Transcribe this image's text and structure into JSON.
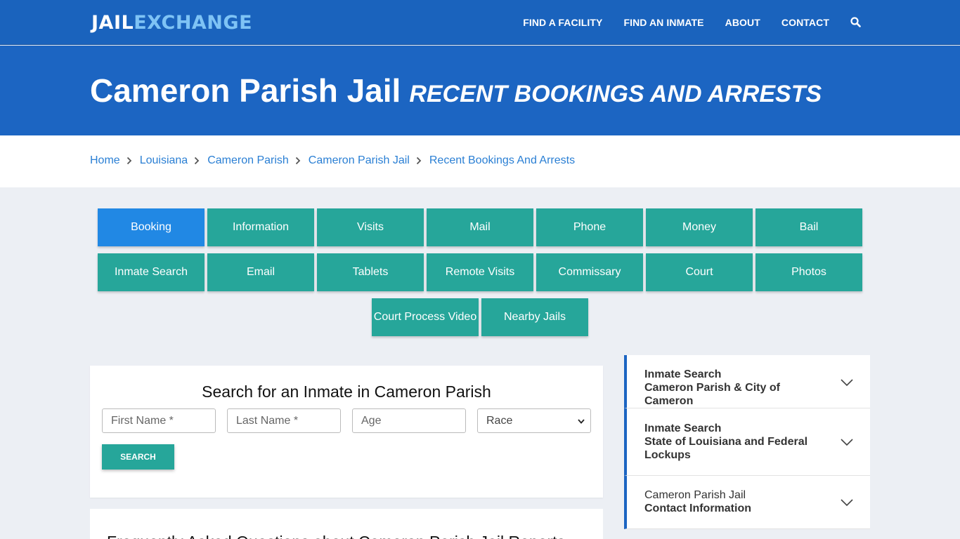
{
  "logo": {
    "part1": "JAIL",
    "part2": "EXCHANGE"
  },
  "nav": {
    "items": [
      "FIND A FACILITY",
      "FIND AN INMATE",
      "ABOUT",
      "CONTACT"
    ],
    "search_icon": "search-icon"
  },
  "hero": {
    "title": "Cameron Parish Jail",
    "subtitle": "RECENT BOOKINGS AND ARRESTS"
  },
  "breadcrumb": [
    "Home",
    "Louisiana",
    "Cameron Parish",
    "Cameron Parish Jail",
    "Recent Bookings And Arrests"
  ],
  "buttons": {
    "row1": [
      "Booking",
      "Information",
      "Visits",
      "Mail",
      "Phone",
      "Money",
      "Bail"
    ],
    "row2": [
      "Inmate Search",
      "Email",
      "Tablets",
      "Remote Visits",
      "Commissary",
      "Court",
      "Photos"
    ],
    "row3": [
      "Court Process Video",
      "Nearby Jails"
    ],
    "active": "Booking"
  },
  "search_card": {
    "title": "Search for an Inmate in Cameron Parish",
    "first_name_placeholder": "First Name *",
    "last_name_placeholder": "Last Name *",
    "age_placeholder": "Age",
    "race_selected": "Race",
    "search_label": "SEARCH"
  },
  "faq": {
    "title": "Frequently Asked Questions about Cameron Parish Jail Reports"
  },
  "accordion": [
    {
      "line1": "Inmate Search",
      "line2": "Cameron Parish & City of Cameron"
    },
    {
      "line1": "Inmate Search",
      "line2": "State of Louisiana and Federal Lockups"
    },
    {
      "line1": "Cameron Parish Jail",
      "line2": "Contact Information"
    }
  ],
  "colors": {
    "nav_blue": "#1a63bd",
    "hero_blue": "#1c65c2",
    "teal": "#26a69a",
    "active_blue": "#2188e4",
    "link_blue": "#2a7fd4"
  }
}
